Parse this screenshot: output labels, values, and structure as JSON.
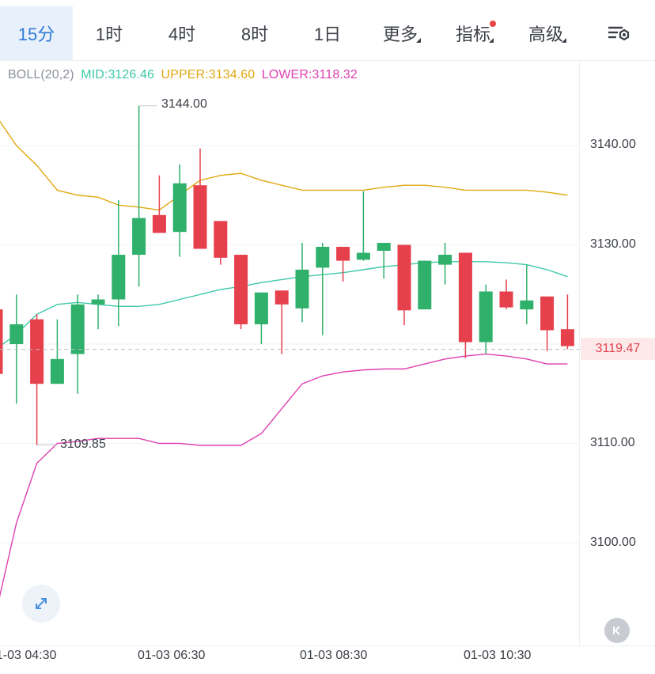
{
  "tabs": {
    "items": [
      {
        "label": "15分"
      },
      {
        "label": "1时"
      },
      {
        "label": "4时"
      },
      {
        "label": "8时"
      },
      {
        "label": "1日"
      },
      {
        "label": "更多"
      },
      {
        "label": "指标"
      },
      {
        "label": "高级"
      }
    ],
    "active_index": 0,
    "settings_icon": "chart-settings-icon"
  },
  "indicator": {
    "name": "BOLL(20,2)",
    "mid": "MID:3126.46",
    "upper": "UPPER:3134.60",
    "lower": "LOWER:3118.32"
  },
  "colors": {
    "up": "#2fb06b",
    "down": "#e6404d",
    "mid": "#3cc9a8",
    "upper": "#e0a911",
    "lower": "#de3fb0",
    "accent": "#2f7bd6",
    "notification": "#e84545"
  },
  "chart_data": {
    "type": "candlestick",
    "y_ticks": [
      "3140.00",
      "3130.00",
      "3110.00",
      "3100.00"
    ],
    "x_ticks": [
      "01-03 04:30",
      "01-03 06:30",
      "01-03 08:30",
      "01-03 10:30"
    ],
    "ylim": [
      3091,
      3146
    ],
    "current_price": "3119.47",
    "high_label": "3144.00",
    "low_label": "3109.85",
    "candles": [
      {
        "o": 3123.5,
        "h": 3123.5,
        "c": 3117.0,
        "l": 3116.5
      },
      {
        "o": 3120.0,
        "h": 3125.0,
        "c": 3122.0,
        "l": 3114.0
      },
      {
        "o": 3122.5,
        "h": 3123.0,
        "c": 3116.0,
        "l": 3109.8
      },
      {
        "o": 3116.0,
        "h": 3122.5,
        "c": 3118.5,
        "l": 3116.0
      },
      {
        "o": 3119.0,
        "h": 3125.0,
        "c": 3124.0,
        "l": 3115.0
      },
      {
        "o": 3124.0,
        "h": 3125.0,
        "c": 3124.5,
        "l": 3121.5
      },
      {
        "o": 3124.5,
        "h": 3134.5,
        "c": 3129.0,
        "l": 3121.8
      },
      {
        "o": 3129.0,
        "h": 3144.0,
        "c": 3132.7,
        "l": 3125.8
      },
      {
        "o": 3133.0,
        "h": 3137.0,
        "c": 3131.2,
        "l": 3131.2
      },
      {
        "o": 3131.3,
        "h": 3138.1,
        "c": 3136.2,
        "l": 3128.8
      },
      {
        "o": 3136.0,
        "h": 3139.7,
        "c": 3129.6,
        "l": 3131.4
      },
      {
        "o": 3132.4,
        "h": 3132.4,
        "c": 3128.7,
        "l": 3128.0
      },
      {
        "o": 3129.0,
        "h": 3129.0,
        "c": 3122.0,
        "l": 3121.5
      },
      {
        "o": 3122.0,
        "h": 3125.2,
        "c": 3125.2,
        "l": 3120.0
      },
      {
        "o": 3125.4,
        "h": 3125.4,
        "c": 3124.0,
        "l": 3119.0
      },
      {
        "o": 3123.6,
        "h": 3130.2,
        "c": 3127.5,
        "l": 3122.2
      },
      {
        "o": 3127.7,
        "h": 3130.2,
        "c": 3129.8,
        "l": 3120.9
      },
      {
        "o": 3129.8,
        "h": 3129.8,
        "c": 3128.4,
        "l": 3126.3
      },
      {
        "o": 3128.5,
        "h": 3135.4,
        "c": 3129.2,
        "l": 3128.4
      },
      {
        "o": 3129.4,
        "h": 3130.2,
        "c": 3130.2,
        "l": 3126.6
      },
      {
        "o": 3130.0,
        "h": 3130.0,
        "c": 3123.4,
        "l": 3121.9
      },
      {
        "o": 3123.5,
        "h": 3128.4,
        "c": 3128.4,
        "l": 3123.5
      },
      {
        "o": 3128.0,
        "h": 3130.2,
        "c": 3129.0,
        "l": 3126.0
      },
      {
        "o": 3129.2,
        "h": 3129.2,
        "c": 3120.2,
        "l": 3118.6
      },
      {
        "o": 3120.2,
        "h": 3126.0,
        "c": 3125.3,
        "l": 3119.0
      },
      {
        "o": 3125.3,
        "h": 3126.5,
        "c": 3123.7,
        "l": 3123.5
      },
      {
        "o": 3123.5,
        "h": 3128.0,
        "c": 3124.4,
        "l": 3122.0
      },
      {
        "o": 3124.8,
        "h": 3124.8,
        "c": 3121.4,
        "l": 3119.3
      },
      {
        "o": 3121.5,
        "h": 3125.0,
        "c": 3119.8,
        "l": 3119.5
      }
    ],
    "upper": [
      3143.0,
      3140.0,
      3138.0,
      3135.5,
      3135.0,
      3134.8,
      3134.0,
      3133.8,
      3133.5,
      3135.0,
      3136.5,
      3137.0,
      3137.2,
      3136.5,
      3136.0,
      3135.5,
      3135.5,
      3135.5,
      3135.5,
      3135.8,
      3136.0,
      3136.0,
      3135.8,
      3135.5,
      3135.5,
      3135.5,
      3135.5,
      3135.3,
      3135.0
    ],
    "mid": [
      3119.5,
      3121.0,
      3123.0,
      3124.0,
      3124.2,
      3124.0,
      3123.8,
      3123.8,
      3124.0,
      3124.5,
      3125.0,
      3125.5,
      3125.8,
      3126.2,
      3126.5,
      3126.8,
      3127.0,
      3127.2,
      3127.5,
      3127.8,
      3128.0,
      3128.2,
      3128.3,
      3128.3,
      3128.3,
      3128.2,
      3128.0,
      3127.5,
      3126.8
    ],
    "lower": [
      3093.0,
      3102.0,
      3108.0,
      3110.0,
      3110.2,
      3110.5,
      3110.5,
      3110.5,
      3110.0,
      3110.0,
      3109.8,
      3109.8,
      3109.8,
      3111.0,
      3113.5,
      3116.0,
      3116.8,
      3117.2,
      3117.4,
      3117.5,
      3117.5,
      3118.0,
      3118.5,
      3118.8,
      3119.0,
      3118.8,
      3118.5,
      3118.0,
      3118.0
    ]
  }
}
